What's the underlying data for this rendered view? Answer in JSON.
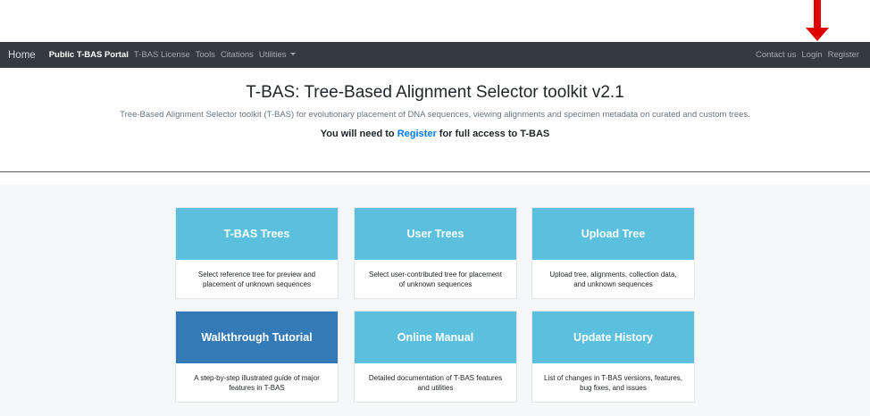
{
  "colors": {
    "navbar_bg": "#343a40",
    "card_light": "#5bc0de",
    "card_dark": "#337ab7",
    "link": "#007bff",
    "annotation_arrow": "#e00000"
  },
  "navbar": {
    "brand": "Home",
    "left_items": [
      {
        "label": "Public T-BAS Portal",
        "active": true
      },
      {
        "label": "T-BAS License"
      },
      {
        "label": "Tools"
      },
      {
        "label": "Citations"
      },
      {
        "label": "Utilities",
        "dropdown": true
      }
    ],
    "right_items": [
      {
        "label": "Contact us"
      },
      {
        "label": "Login"
      },
      {
        "label": "Register"
      }
    ]
  },
  "header": {
    "title": "T-BAS: Tree-Based Alignment Selector toolkit v2.1",
    "subtitle": "Tree-Based Alignment Selector toolkit (T-BAS) for evolutionary placement of DNA sequences, viewing alignments and specimen metadata on curated and custom trees.",
    "register_prefix": "You will need to",
    "register_link": "Register",
    "register_suffix": "for full access to T-BAS"
  },
  "cards": [
    {
      "title": "T-BAS Trees",
      "description": "Select reference tree for preview and placement of unknown sequences"
    },
    {
      "title": "User Trees",
      "description": "Select user-contributed tree for placement of unknown sequences"
    },
    {
      "title": "Upload Tree",
      "description": "Upload tree, alignments, collection data, and unknown sequences"
    },
    {
      "title": "Walkthrough Tutorial",
      "description": "A step-by-step illustrated guide of major features in T-BAS"
    },
    {
      "title": "Online Manual",
      "description": "Detailed documentation of T-BAS features and utilities"
    },
    {
      "title": "Update History",
      "description": "List of changes in T-BAS versions, features, bug fixes, and issues"
    }
  ]
}
